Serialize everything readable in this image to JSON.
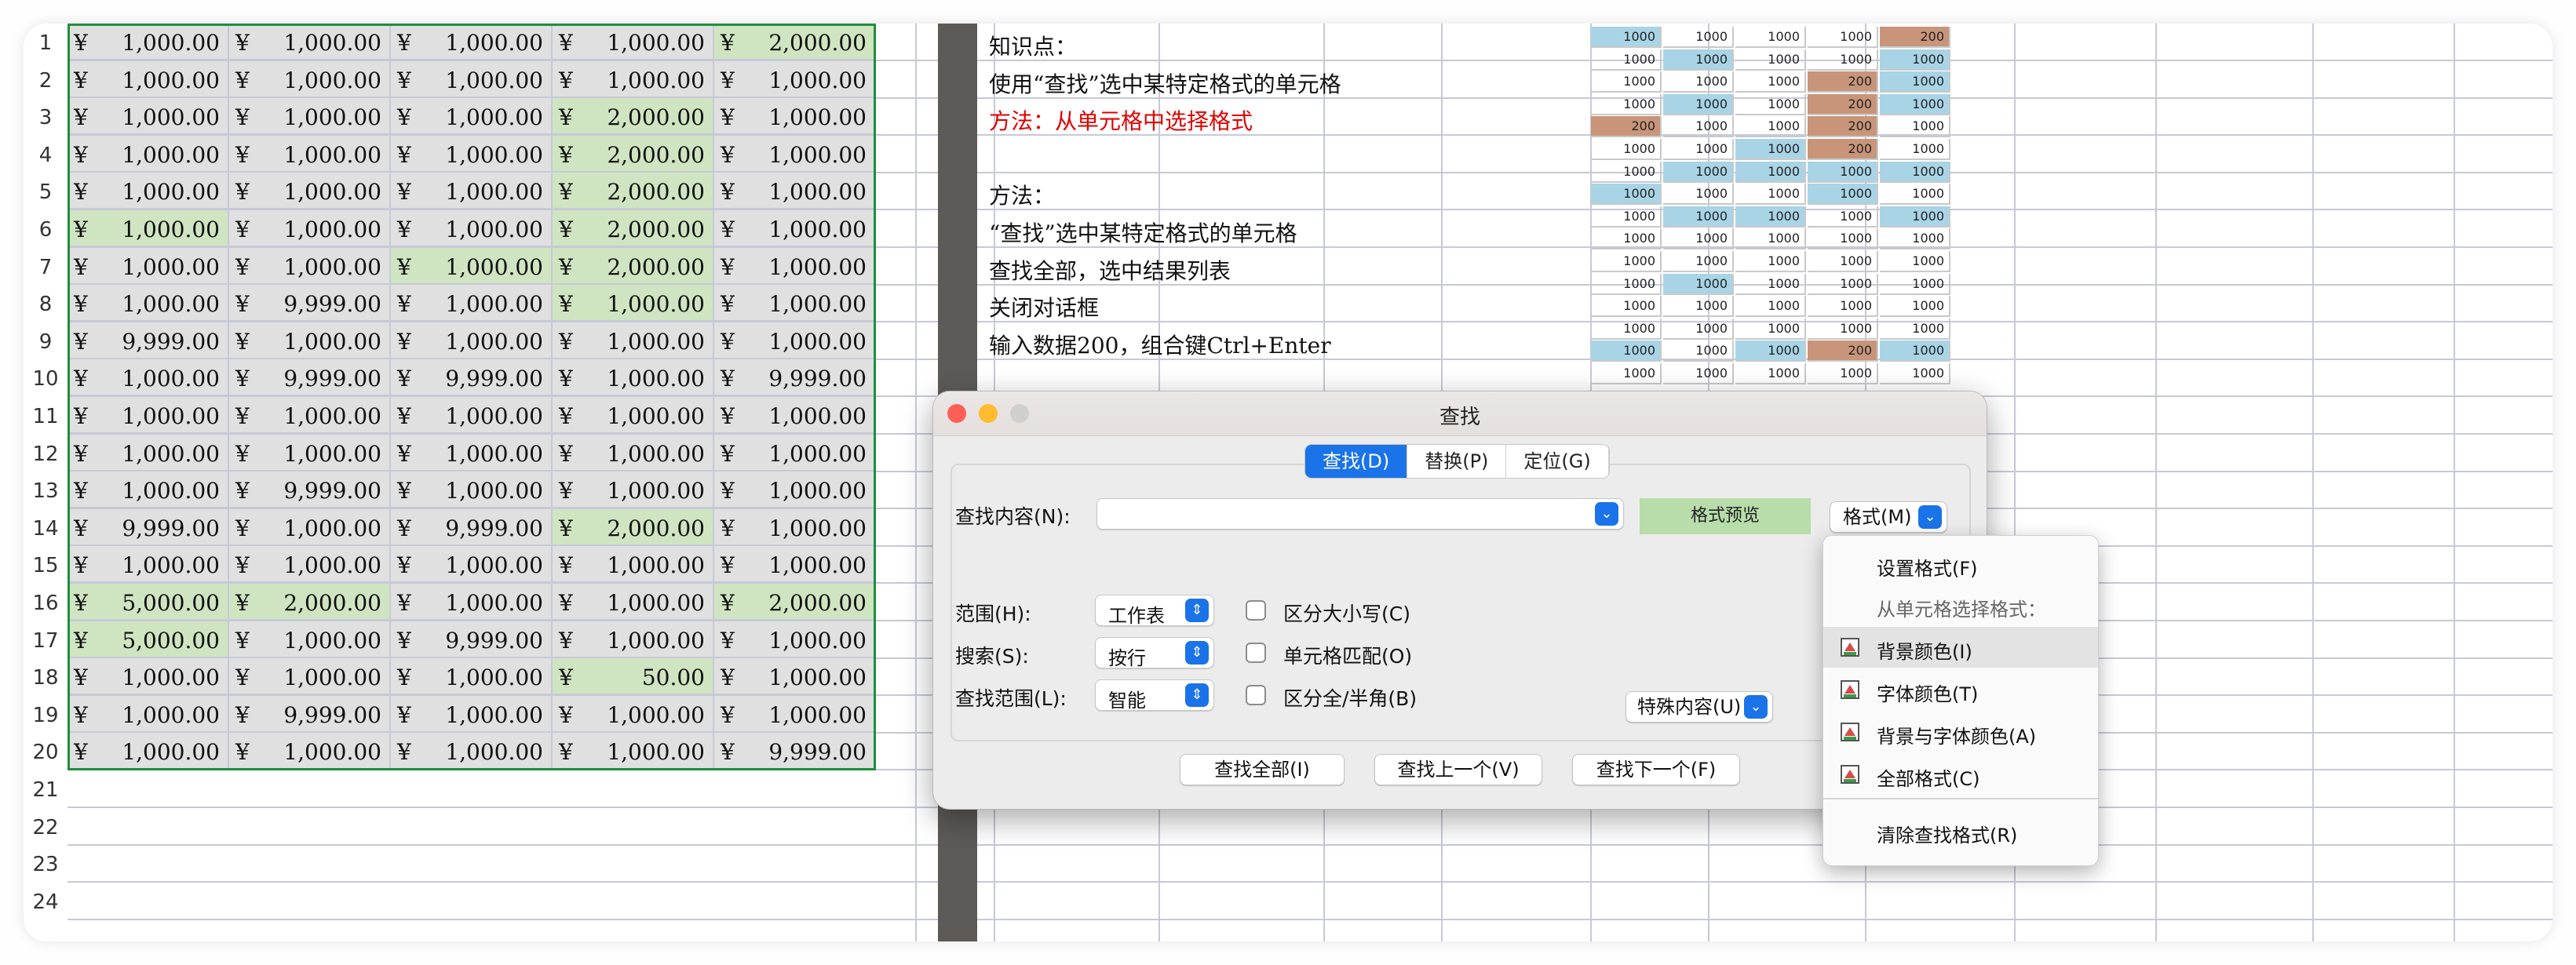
{
  "row_numbers": [
    "1",
    "2",
    "3",
    "4",
    "5",
    "6",
    "7",
    "8",
    "9",
    "10",
    "11",
    "12",
    "13",
    "14",
    "15",
    "16",
    "17",
    "18",
    "19",
    "20",
    "21",
    "22",
    "23",
    "24"
  ],
  "currency_symbol": "¥",
  "table_rows": [
    [
      "1,000.00",
      "1,000.00",
      "1,000.00",
      "1,000.00",
      "2,000.00"
    ],
    [
      "1,000.00",
      "1,000.00",
      "1,000.00",
      "1,000.00",
      "1,000.00"
    ],
    [
      "1,000.00",
      "1,000.00",
      "1,000.00",
      "2,000.00",
      "1,000.00"
    ],
    [
      "1,000.00",
      "1,000.00",
      "1,000.00",
      "2,000.00",
      "1,000.00"
    ],
    [
      "1,000.00",
      "1,000.00",
      "1,000.00",
      "2,000.00",
      "1,000.00"
    ],
    [
      "1,000.00",
      "1,000.00",
      "1,000.00",
      "2,000.00",
      "1,000.00"
    ],
    [
      "1,000.00",
      "1,000.00",
      "1,000.00",
      "2,000.00",
      "1,000.00"
    ],
    [
      "1,000.00",
      "9,999.00",
      "1,000.00",
      "1,000.00",
      "1,000.00"
    ],
    [
      "9,999.00",
      "1,000.00",
      "1,000.00",
      "1,000.00",
      "1,000.00"
    ],
    [
      "1,000.00",
      "9,999.00",
      "9,999.00",
      "1,000.00",
      "9,999.00"
    ],
    [
      "1,000.00",
      "1,000.00",
      "1,000.00",
      "1,000.00",
      "1,000.00"
    ],
    [
      "1,000.00",
      "1,000.00",
      "1,000.00",
      "1,000.00",
      "1,000.00"
    ],
    [
      "1,000.00",
      "9,999.00",
      "1,000.00",
      "1,000.00",
      "1,000.00"
    ],
    [
      "9,999.00",
      "1,000.00",
      "9,999.00",
      "2,000.00",
      "1,000.00"
    ],
    [
      "1,000.00",
      "1,000.00",
      "1,000.00",
      "1,000.00",
      "1,000.00"
    ],
    [
      "5,000.00",
      "2,000.00",
      "1,000.00",
      "1,000.00",
      "2,000.00"
    ],
    [
      "5,000.00",
      "1,000.00",
      "9,999.00",
      "1,000.00",
      "1,000.00"
    ],
    [
      "1,000.00",
      "1,000.00",
      "1,000.00",
      "50.00",
      "1,000.00"
    ],
    [
      "1,000.00",
      "9,999.00",
      "1,000.00",
      "1,000.00",
      "1,000.00"
    ],
    [
      "1,000.00",
      "1,000.00",
      "1,000.00",
      "1,000.00",
      "9,999.00"
    ]
  ],
  "table_fill": [
    [
      "g",
      "g",
      "g",
      "g",
      "G"
    ],
    [
      "g",
      "g",
      "g",
      "g",
      "g"
    ],
    [
      "g",
      "g",
      "g",
      "G",
      "g"
    ],
    [
      "g",
      "g",
      "g",
      "G",
      "g"
    ],
    [
      "g",
      "g",
      "g",
      "G",
      "g"
    ],
    [
      "G",
      "g",
      "g",
      "G",
      "g"
    ],
    [
      "g",
      "g",
      "G",
      "G",
      "g"
    ],
    [
      "g",
      "g",
      "g",
      "G",
      "g"
    ],
    [
      "g",
      "g",
      "g",
      "g",
      "g"
    ],
    [
      "g",
      "g",
      "g",
      "g",
      "g"
    ],
    [
      "g",
      "g",
      "g",
      "g",
      "g"
    ],
    [
      "g",
      "g",
      "g",
      "g",
      "g"
    ],
    [
      "g",
      "g",
      "g",
      "g",
      "g"
    ],
    [
      "g",
      "g",
      "g",
      "G",
      "g"
    ],
    [
      "g",
      "g",
      "g",
      "g",
      "g"
    ],
    [
      "G",
      "G",
      "g",
      "g",
      "G"
    ],
    [
      "G",
      "g",
      "g",
      "g",
      "g"
    ],
    [
      "g",
      "g",
      "g",
      "G",
      "g"
    ],
    [
      "g",
      "g",
      "g",
      "g",
      "g"
    ],
    [
      "g",
      "g",
      "g",
      "g",
      "g"
    ]
  ],
  "colors": {
    "cell_gray": "#e0e0e0",
    "cell_green": "#cfe5c1",
    "selection": "#1e8f3e",
    "mini_blue": "#a8d4e6",
    "mini_brown": "#c8957a",
    "accent": "#1a73e8"
  },
  "notes": [
    {
      "text": "知识点：",
      "red": false
    },
    {
      "text": "使用“查找”选中某特定格式的单元格",
      "red": false
    },
    {
      "text": "方法：从单元格中选择格式",
      "red": true
    },
    {
      "text": "",
      "red": false
    },
    {
      "text": "方法：",
      "red": false
    },
    {
      "text": "“查找”选中某特定格式的单元格",
      "red": false
    },
    {
      "text": "查找全部，选中结果列表",
      "red": false
    },
    {
      "text": "关闭对话框",
      "red": false
    },
    {
      "text": "输入数据200，组合键Ctrl+Enter",
      "red": false
    }
  ],
  "mini_table": [
    [
      "1000",
      "1000",
      "1000",
      "1000",
      "200"
    ],
    [
      "1000",
      "1000",
      "1000",
      "1000",
      "1000"
    ],
    [
      "1000",
      "1000",
      "1000",
      "200",
      "1000"
    ],
    [
      "1000",
      "1000",
      "1000",
      "200",
      "1000"
    ],
    [
      "200",
      "1000",
      "1000",
      "200",
      "1000"
    ],
    [
      "1000",
      "1000",
      "1000",
      "200",
      "1000"
    ],
    [
      "1000",
      "1000",
      "1000",
      "1000",
      "1000"
    ],
    [
      "1000",
      "1000",
      "1000",
      "1000",
      "1000"
    ],
    [
      "1000",
      "1000",
      "1000",
      "1000",
      "1000"
    ],
    [
      "1000",
      "1000",
      "1000",
      "1000",
      "1000"
    ],
    [
      "1000",
      "1000",
      "1000",
      "1000",
      "1000"
    ],
    [
      "1000",
      "1000",
      "1000",
      "1000",
      "1000"
    ],
    [
      "1000",
      "1000",
      "1000",
      "1000",
      "1000"
    ],
    [
      "1000",
      "1000",
      "1000",
      "1000",
      "1000"
    ],
    [
      "1000",
      "1000",
      "1000",
      "200",
      "1000"
    ],
    [
      "1000",
      "1000",
      "1000",
      "1000",
      "1000"
    ]
  ],
  "mini_fill": [
    [
      "b",
      "",
      "",
      "",
      "r"
    ],
    [
      "",
      "b",
      "",
      "",
      "b"
    ],
    [
      "",
      "",
      "",
      "r",
      "b"
    ],
    [
      "",
      "b",
      "",
      "r",
      "b"
    ],
    [
      "r",
      "",
      "",
      "r",
      ""
    ],
    [
      "",
      "",
      "b",
      "r",
      ""
    ],
    [
      "",
      "b",
      "b",
      "b",
      "b"
    ],
    [
      "b",
      "",
      "",
      "b",
      ""
    ],
    [
      "",
      "b",
      "b",
      "",
      "b"
    ],
    [
      "",
      "",
      "",
      "",
      ""
    ],
    [
      "",
      "",
      "",
      "",
      ""
    ],
    [
      "",
      "b",
      "",
      "",
      ""
    ],
    [
      "",
      "",
      "",
      "",
      ""
    ],
    [
      "",
      "",
      "",
      "",
      ""
    ],
    [
      "b",
      "",
      "b",
      "r",
      "b"
    ],
    [
      "",
      "",
      "",
      "",
      ""
    ]
  ],
  "dialog": {
    "title": "查找",
    "tabs": [
      {
        "label": "查找(D)",
        "active": true
      },
      {
        "label": "替换(P)",
        "active": false
      },
      {
        "label": "定位(G)",
        "active": false
      }
    ],
    "find_label": "查找内容(N):",
    "find_value": "",
    "format_preview": "格式预览",
    "format_button": "格式(M)",
    "scope_label": "范围(H):",
    "scope_value": "工作表",
    "search_label": "搜索(S):",
    "search_value": "按行",
    "lookin_label": "查找范围(L):",
    "lookin_value": "智能",
    "opt_case": "区分大小写(C)",
    "opt_match": "单元格匹配(O)",
    "opt_width": "区分全/半角(B)",
    "special_button": "特殊内容(U)",
    "find_all": "查找全部(I)",
    "find_prev": "查找上一个(V)",
    "find_next": "查找下一个(F)"
  },
  "menu": {
    "items": [
      {
        "label": "设置格式(F)",
        "icon": "",
        "sub": false,
        "hi": false
      },
      {
        "label": "从单元格选择格式：",
        "icon": "",
        "sub": true,
        "hi": false
      },
      {
        "label": "背景颜色(I)",
        "icon": "bg-color-icon",
        "sub": false,
        "hi": true
      },
      {
        "label": "字体颜色(T)",
        "icon": "font-color-icon",
        "sub": false,
        "hi": false
      },
      {
        "label": "背景与字体颜色(A)",
        "icon": "bg-font-color-icon",
        "sub": false,
        "hi": false
      },
      {
        "label": "全部格式(C)",
        "icon": "all-format-icon",
        "sub": false,
        "hi": false
      },
      {
        "label": "清除查找格式(R)",
        "icon": "",
        "sub": false,
        "hi": false
      }
    ]
  }
}
